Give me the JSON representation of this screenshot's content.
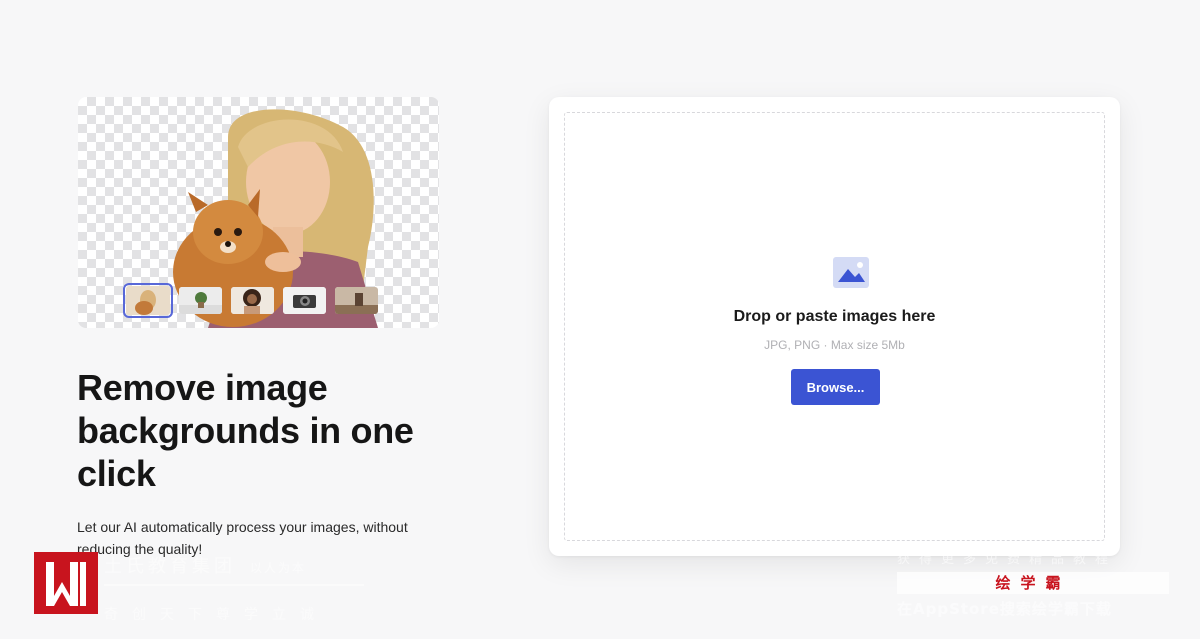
{
  "hero": {
    "thumbnails": [
      {
        "name": "woman-with-dog",
        "active": true
      },
      {
        "name": "plant",
        "active": false
      },
      {
        "name": "woman-portrait",
        "active": false
      },
      {
        "name": "camera",
        "active": false
      },
      {
        "name": "room-scene",
        "active": false
      }
    ]
  },
  "headline": "Remove image backgrounds in one click",
  "subtext": "Let our AI automatically process your images, without reducing the quality!",
  "upload": {
    "icon": "image-icon",
    "title": "Drop or paste images here",
    "hint": "JPG, PNG · Max size 5Mb",
    "browse_label": "Browse..."
  },
  "watermark": {
    "left_line1": "土氏教育集团",
    "left_line1_small": "以人为本",
    "left_line2": "奇创天下尊学立诚",
    "right_line1": "获得更多免费精品教程",
    "right_band": "绘学霸",
    "right_line3": "在AppStore搜索绘学霸下载"
  },
  "colors": {
    "accent": "#3b54d3",
    "background": "#f7f7f8",
    "watermark_red": "#c8141e"
  }
}
